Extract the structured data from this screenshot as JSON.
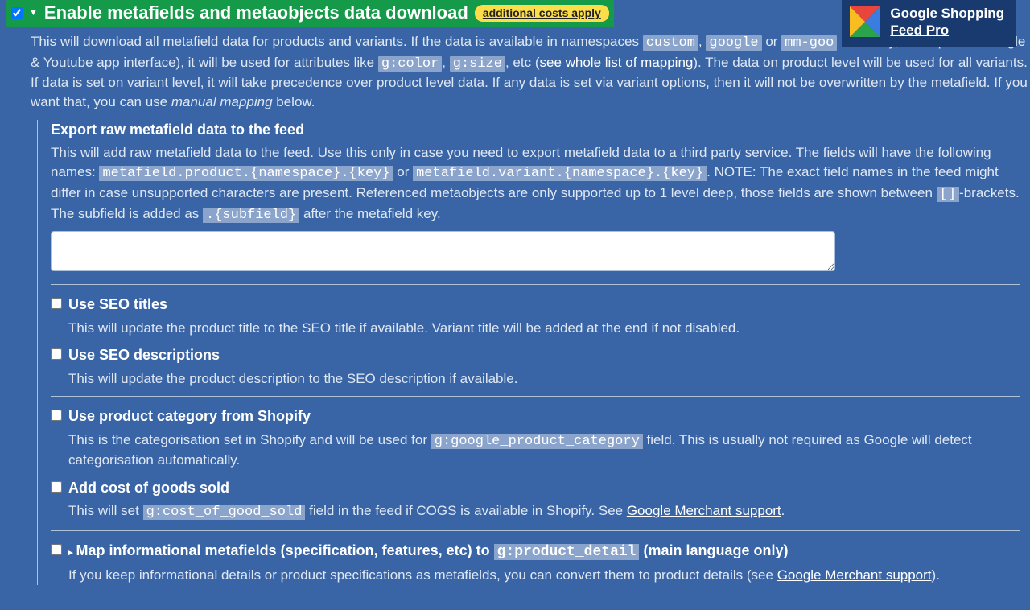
{
  "badge": {
    "line1": "Google Shopping",
    "line2": "Feed Pro"
  },
  "header": {
    "title": "Enable metafields and metaobjects data download",
    "pill": "additional costs apply"
  },
  "desc1a": "This will download all metafield data for products and variants. If the data is available in namespaces ",
  "ns1": "custom",
  "ns2": "google",
  "ns3": "mm-goo",
  "desc1b": " or ",
  "desc1c": " manually, via import or Google & Youtube app interface), it will be used for attributes like ",
  "attr1": "g:color",
  "attr2": "g:size",
  "desc1d": ", etc (",
  "link1": "see whole list of mapping",
  "desc1e": "). The data on product level will be used for all variants. If data is set on variant level, it will take precedence over product level data. If any data is set via variant options, then it will not be overwritten by the metafield. If you want that, you can use ",
  "manual": "manual mapping",
  "desc1f": " below.",
  "export": {
    "title": "Export raw metafield data to the feed",
    "p1": "This will add raw metafield data to the feed. Use this only in case you need to export metafield data to a third party service. The fields will have the following names: ",
    "c1": "metafield.product.{namespace}.{key}",
    "or": " or ",
    "c2": "metafield.variant.{namespace}.{key}",
    "p2": ". NOTE: The exact field names in the feed might differ in case unsupported characters are present. Referenced metaobjects are only supported up to 1 level deep, those fields are shown between ",
    "c3": "[]",
    "p3": "-brackets. The subfield is added as ",
    "c4": ".{subfield}",
    "p4": " after the metafield key."
  },
  "seoTitle": {
    "lbl": "Use SEO titles",
    "desc": "This will update the product title to the SEO title if available. Variant title will be added at the end if not disabled."
  },
  "seoDesc": {
    "lbl": "Use SEO descriptions",
    "desc": "This will update the product description to the SEO description if available."
  },
  "cat": {
    "lbl": "Use product category from Shopify",
    "d1": "This is the categorisation set in Shopify and will be used for ",
    "c": "g:google_product_category",
    "d2": " field. This is usually not required as Google will detect categorisation automatically."
  },
  "cogs": {
    "lbl": "Add cost of goods sold",
    "d1": "This will set ",
    "c": "g:cost_of_good_sold",
    "d2": " field in the feed if COGS is available in Shopify. See ",
    "link": "Google Merchant support",
    "d3": "."
  },
  "map": {
    "l1": "Map informational metafields (specification, features, etc) to ",
    "c": "g:product_detail",
    "l2": " (main language only)",
    "d1": "If you keep informational details or product specifications as metafields, you can convert them to product details (see ",
    "link": "Google Merchant support",
    "d2": ")."
  }
}
